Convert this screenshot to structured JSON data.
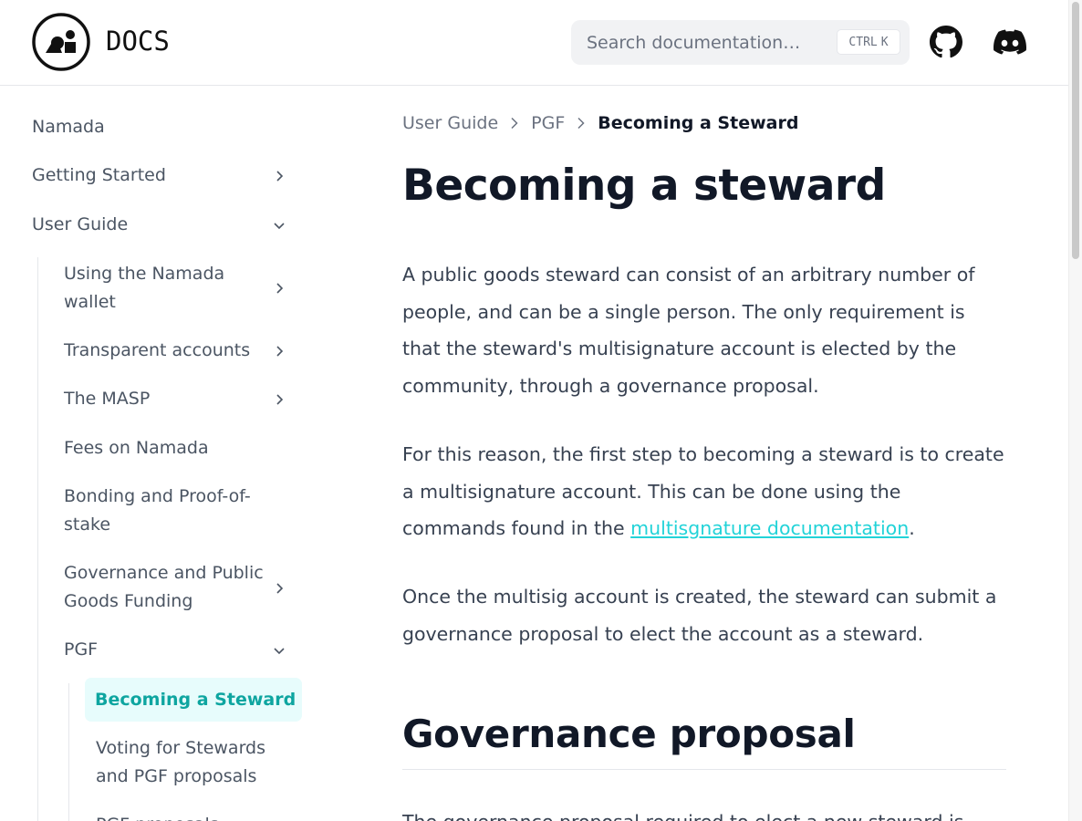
{
  "header": {
    "brand": "DOCS",
    "search": {
      "placeholder": "Search documentation…",
      "shortcut_ctrl": "CTRL",
      "shortcut_key": "K"
    }
  },
  "sidebar": {
    "items": [
      {
        "label": "Namada"
      },
      {
        "label": "Getting Started"
      },
      {
        "label": "User Guide"
      },
      {
        "label": "Using the Namada wallet"
      },
      {
        "label": "Transparent accounts"
      },
      {
        "label": "The MASP"
      },
      {
        "label": "Fees on Namada"
      },
      {
        "label": "Bonding and Proof-of-stake"
      },
      {
        "label": "Governance and Public Goods Funding"
      },
      {
        "label": "PGF"
      },
      {
        "label": "Becoming a Steward"
      },
      {
        "label": "Voting for Stewards and PGF proposals"
      },
      {
        "label": "PGF proposals"
      }
    ]
  },
  "breadcrumb": {
    "item1": "User Guide",
    "item2": "PGF",
    "current": "Becoming a Steward"
  },
  "content": {
    "title": "Becoming a steward",
    "p1": "A public goods steward can consist of an arbitrary number of people, and can be a single person. The only requirement is that the steward's multisignature account is elected by the community, through a governance proposal.",
    "p2_before": "For this reason, the first step to becoming a steward is to create a multisignature account. This can be done using the commands found in the ",
    "p2_link": "multisgnature documentation",
    "p2_after": ".",
    "p3": "Once the multisig account is created, the steward can submit a governance proposal to elect the account as a steward.",
    "h2": "Governance proposal",
    "p4": "The governance proposal required to elect a new steward is"
  },
  "colors": {
    "accent": "#0ea5a0",
    "active_bg": "#e7fcfc",
    "link": "#22d3d8",
    "heading": "#111827",
    "text": "#374151"
  },
  "icons": [
    "namada-logo",
    "github-icon",
    "discord-icon",
    "chevron-right-icon",
    "chevron-down-icon"
  ]
}
